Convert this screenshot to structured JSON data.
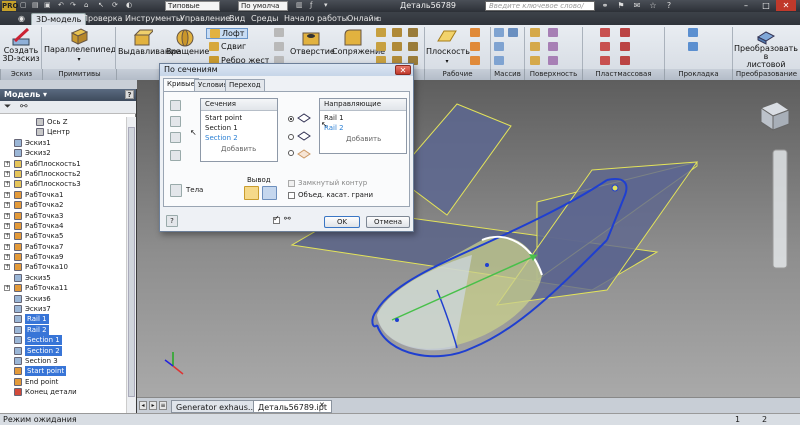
{
  "colors": {
    "accent": "#3875d7",
    "titlebar": "#2c3037",
    "viewport_bg": "#8e8e8e",
    "model_curve": "#1f3fd0",
    "surface": "#c9d08c",
    "plane": "#5d6790",
    "plane_edge": "#e3e35a"
  },
  "titlebar": {
    "logo": "PRO",
    "style_combo": "Типовые",
    "material_combo": "По умолча",
    "doc_title": "Деталь56789",
    "search_placeholder": "Введите ключевое слово/фразу",
    "window_buttons": [
      "–",
      "□",
      "✕"
    ]
  },
  "tabs": [
    "3D-модель",
    "Проверка",
    "Инструменты",
    "Управление",
    "Вид",
    "Среды",
    "Начало работы",
    "Онлайн"
  ],
  "ribbon": {
    "sketch_button": "Создать\n3D-эскиз",
    "box_dropdown": "Параллелепипед",
    "extrude": "Выдавливание",
    "revolve": "Вращение",
    "loft": "Лофт",
    "sweep": "Сдвиг",
    "ribbon_more": "Ребро жесткости",
    "hole": "Отверстие",
    "fillet": "Сопряжение",
    "plane": "Плоскость",
    "convert": "Преобразовать в\nлистовой металл",
    "groups": [
      "Эскиз",
      "Примитивы",
      "Рабочие элементы",
      "Массив",
      "Поверхность",
      "Пластмассовая деталь",
      "Прокладка кабелей",
      "Преобразование"
    ]
  },
  "browser": {
    "title": "Модель ▾",
    "help": "?",
    "items": [
      {
        "label": "Ось Z",
        "icon": "axis-icon",
        "indent": 3
      },
      {
        "label": "Центр",
        "icon": "point-icon",
        "indent": 3
      },
      {
        "label": "Эскиз1",
        "icon": "sketch-icon",
        "indent": 1
      },
      {
        "label": "Эскиз2",
        "icon": "sketch-icon",
        "indent": 1
      },
      {
        "label": "РабПлоскость1",
        "icon": "plane-icon",
        "indent": 1
      },
      {
        "label": "РабПлоскость2",
        "icon": "plane-icon",
        "indent": 1
      },
      {
        "label": "РабПлоскость3",
        "icon": "plane-icon",
        "indent": 1
      },
      {
        "label": "РабТочка1",
        "icon": "workpoint-icon",
        "indent": 1
      },
      {
        "label": "РабТочка2",
        "icon": "workpoint-icon",
        "indent": 1
      },
      {
        "label": "РабТочка3",
        "icon": "workpoint-icon",
        "indent": 1
      },
      {
        "label": "РабТочка4",
        "icon": "workpoint-icon",
        "indent": 1
      },
      {
        "label": "РабТочка5",
        "icon": "workpoint-icon",
        "indent": 1
      },
      {
        "label": "РабТочка7",
        "icon": "workpoint-icon",
        "indent": 1
      },
      {
        "label": "РабТочка9",
        "icon": "workpoint-icon",
        "indent": 1
      },
      {
        "label": "РабТочка10",
        "icon": "workpoint-icon",
        "indent": 1
      },
      {
        "label": "Эскиз5",
        "icon": "sketch-icon",
        "indent": 1
      },
      {
        "label": "РабТочка11",
        "icon": "workpoint-icon",
        "indent": 1
      },
      {
        "label": "Эскиз6",
        "icon": "sketch-icon",
        "indent": 1
      },
      {
        "label": "Эскиз7",
        "icon": "sketch-icon",
        "indent": 1
      },
      {
        "label": "Rail 1",
        "icon": "sketch-icon",
        "indent": 1,
        "selected": true
      },
      {
        "label": "Rail 2",
        "icon": "sketch-icon",
        "indent": 1,
        "selected": true
      },
      {
        "label": "Section 1",
        "icon": "sketch-icon",
        "indent": 1,
        "selected": true
      },
      {
        "label": "Section 2",
        "icon": "sketch-icon",
        "indent": 1,
        "selected": true
      },
      {
        "label": "Section 3",
        "icon": "sketch-icon",
        "indent": 1
      },
      {
        "label": "Start point",
        "icon": "workpoint-icon",
        "indent": 1,
        "selected": true
      },
      {
        "label": "End point",
        "icon": "workpoint-icon",
        "indent": 1
      },
      {
        "label": "Конец детали",
        "icon": "end-of-part-icon",
        "indent": 1
      }
    ]
  },
  "doctabs": [
    "Generator exhaus....ipt",
    "Деталь56789.ipt"
  ],
  "status": {
    "text": "Режим ожидания",
    "count1": "1",
    "count2": "2"
  },
  "dialog": {
    "title": "По сечениям",
    "tabs": [
      "Кривые",
      "Условия",
      "Переход"
    ],
    "sections_header": "Сечения",
    "sections": [
      "Start point",
      "Section 1",
      "Section 2"
    ],
    "sections_add": "Добавить",
    "rails_header": "Направляющие",
    "rails": [
      "Rail 1",
      "Rail 2"
    ],
    "rails_add": "Добавить",
    "solids_label": "Тела",
    "output_label": "Вывод",
    "closed_loop": "Замкнутый контур",
    "merge_faces": "Объед. касат. грани",
    "ok": "OK",
    "cancel": "Отмена",
    "help": "?"
  }
}
